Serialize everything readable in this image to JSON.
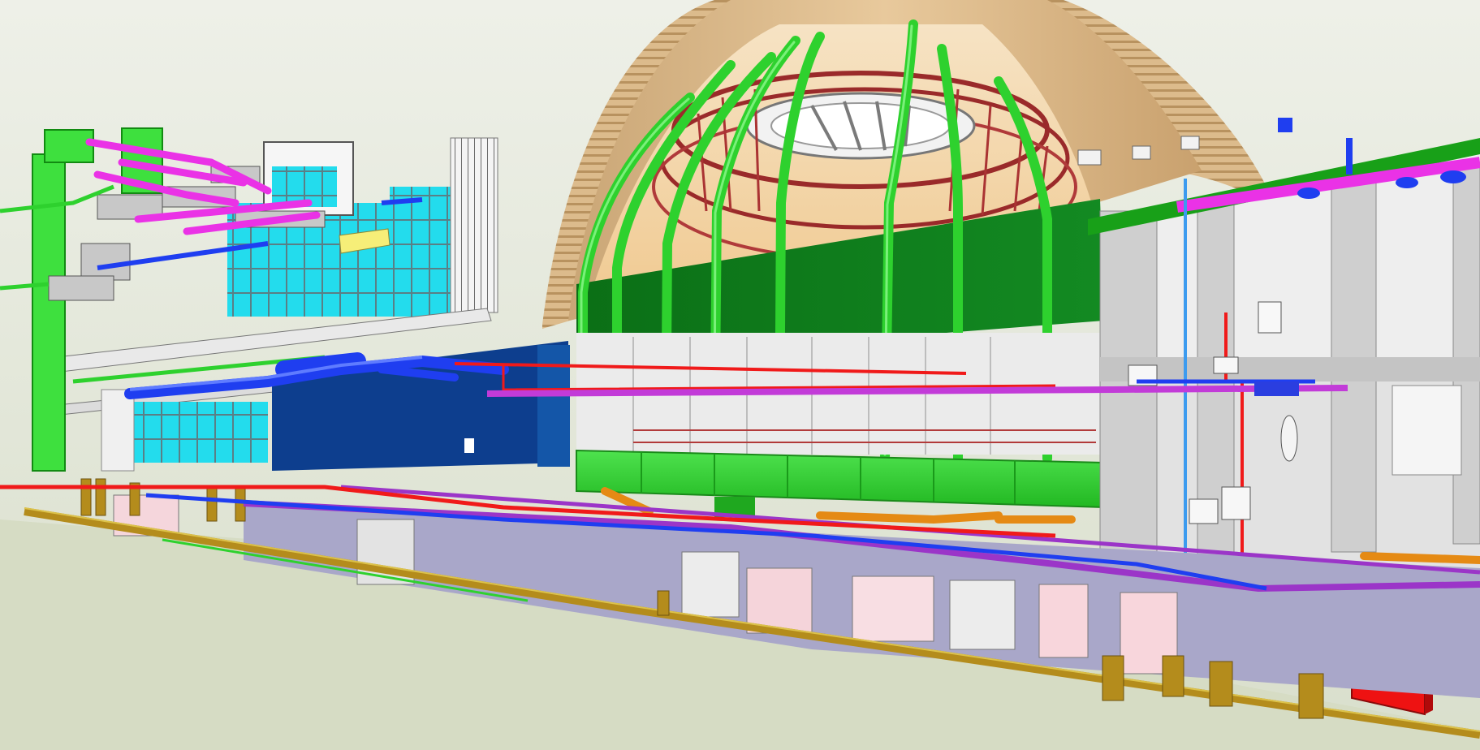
{
  "viewer": {
    "view_type": "3D perspective",
    "colors": {
      "background_top": "#eef0e8",
      "background_bottom": "#d9dfcc",
      "dome_timber": "#d8b88a",
      "structural_ring": "#9a2a2a",
      "green_pipe": "#2ed12e",
      "green_slab": "#0f7a1a",
      "green_platform": "#3cd23c",
      "gas_pipe": "#b48c1c",
      "drainage_pipe": "#e58a14",
      "hvac_duct_blue": "#1f3ef0",
      "magenta_duct": "#ea32e6",
      "purple_pipe": "#9b35c8",
      "fire_pipe": "#f01a1a",
      "glazing": "#19dcee",
      "navy_wall": "#0d3e8e",
      "concrete_grey": "#c8c8c8",
      "pink_wall": "#f8d6dc",
      "fire_cabinet": "#ee1212",
      "yellow_panel": "#f6ee78"
    }
  }
}
